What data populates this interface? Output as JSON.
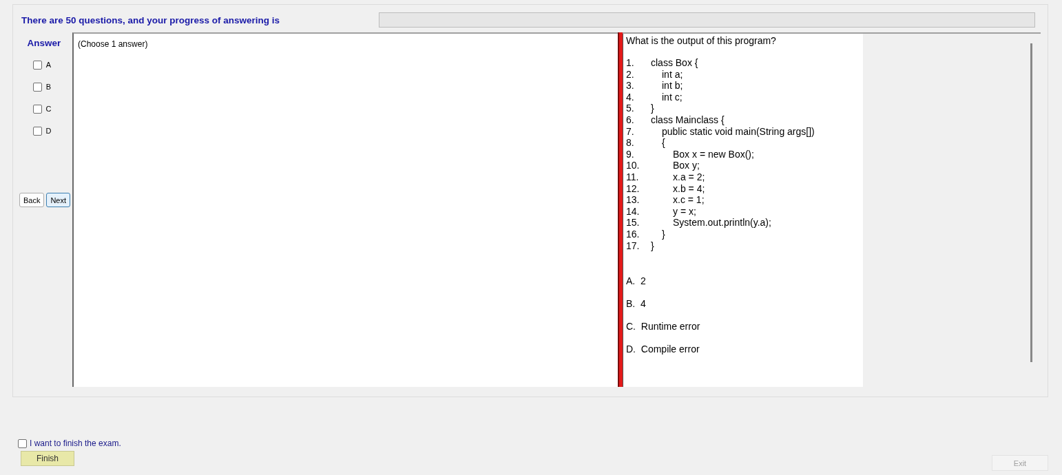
{
  "header": {
    "progress_text": "There are 50 questions, and your progress of answering is",
    "progress_bar": true
  },
  "answer_panel": {
    "title": "Answer",
    "options": [
      {
        "label": "A",
        "checked": false
      },
      {
        "label": "B",
        "checked": false
      },
      {
        "label": "C",
        "checked": false
      },
      {
        "label": "D",
        "checked": false
      }
    ],
    "buttons": [
      {
        "label": "Back",
        "focused": false
      },
      {
        "label": "Next",
        "focused": true
      }
    ]
  },
  "instruction": "(Choose 1 answer)",
  "question": {
    "prompt": "What is the output of this program?",
    "code": [
      {
        "number": "1.",
        "text": "class Box {",
        "children": [
          {
            "number": "2.",
            "text": "int a;"
          },
          {
            "number": "3.",
            "text": "int b;"
          },
          {
            "number": "4.",
            "text": "int c;"
          }
        ]
      },
      {
        "number": "5.",
        "text": "}"
      },
      {
        "number": "6.",
        "text": "class Mainclass {",
        "children": [
          {
            "number": "7.",
            "text": "public static void main(String args[])"
          },
          {
            "number": "8.",
            "text": "{",
            "children": [
              {
                "number": "9.",
                "text": "Box x = new Box();"
              },
              {
                "number": "10.",
                "text": "Box y;"
              },
              {
                "number": "11.",
                "text": "x.a = 2;"
              },
              {
                "number": "12.",
                "text": "x.b = 4;"
              },
              {
                "number": "13.",
                "text": "x.c = 1;"
              },
              {
                "number": "14.",
                "text": "y = x;"
              },
              {
                "number": "15.",
                "text": "System.out.println(y.a);"
              }
            ]
          },
          {
            "number": "16.",
            "text": "}"
          }
        ]
      },
      {
        "number": "17.",
        "text": "}"
      }
    ],
    "choices": [
      {
        "letter": "A.",
        "text": "2"
      },
      {
        "letter": "B.",
        "text": "4"
      },
      {
        "letter": "C.",
        "text": "Runtime error"
      },
      {
        "letter": "D.",
        "text": "Compile error"
      }
    ]
  },
  "finish": {
    "label": "I want to finish the exam.",
    "checked": false,
    "button": "Finish"
  },
  "exit": {
    "label": "Exit",
    "disabled": true
  }
}
